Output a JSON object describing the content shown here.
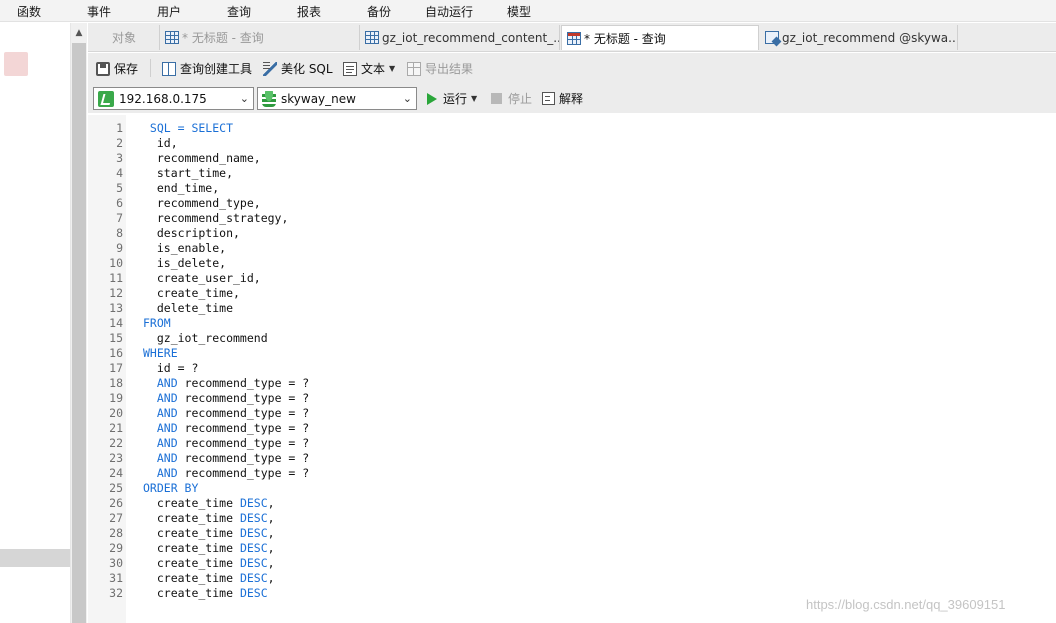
{
  "menu": [
    "函数",
    "事件",
    "用户",
    "查询",
    "报表",
    "备份",
    "自动运行",
    "模型"
  ],
  "tabs": [
    {
      "label": "对象",
      "state": "inactive"
    },
    {
      "label": "* 无标题 - 查询",
      "state": "inactive"
    },
    {
      "label": "gz_iot_recommend_content_...",
      "state": "normal"
    },
    {
      "label": "* 无标题 - 查询",
      "state": "active"
    },
    {
      "label": "gz_iot_recommend @skywa...",
      "state": "normal"
    }
  ],
  "toolbar": {
    "save": "保存",
    "query_builder": "查询创建工具",
    "beautify": "美化 SQL",
    "text": "文本",
    "export": "导出结果"
  },
  "selectors": {
    "connection": "192.168.0.175",
    "database": "skyway_new"
  },
  "run_bar": {
    "run": "运行",
    "stop": "停止",
    "explain": "解释"
  },
  "editor": {
    "lines": [
      {
        "n": "1",
        "parts": [
          {
            "t": " SQL = SELECT",
            "k": true
          }
        ]
      },
      {
        "n": "2",
        "parts": [
          {
            "t": "  id,"
          }
        ]
      },
      {
        "n": "3",
        "parts": [
          {
            "t": "  recommend_name,"
          }
        ]
      },
      {
        "n": "4",
        "parts": [
          {
            "t": "  start_time,"
          }
        ]
      },
      {
        "n": "5",
        "parts": [
          {
            "t": "  end_time,"
          }
        ]
      },
      {
        "n": "6",
        "parts": [
          {
            "t": "  recommend_type,"
          }
        ]
      },
      {
        "n": "7",
        "parts": [
          {
            "t": "  recommend_strategy,"
          }
        ]
      },
      {
        "n": "8",
        "parts": [
          {
            "t": "  description,"
          }
        ]
      },
      {
        "n": "9",
        "parts": [
          {
            "t": "  is_enable,"
          }
        ]
      },
      {
        "n": "10",
        "parts": [
          {
            "t": "  is_delete,"
          }
        ]
      },
      {
        "n": "11",
        "parts": [
          {
            "t": "  create_user_id,"
          }
        ]
      },
      {
        "n": "12",
        "parts": [
          {
            "t": "  create_time,"
          }
        ]
      },
      {
        "n": "13",
        "parts": [
          {
            "t": "  delete_time"
          }
        ]
      },
      {
        "n": "14",
        "parts": [
          {
            "t": "FROM",
            "k": true
          }
        ]
      },
      {
        "n": "15",
        "parts": [
          {
            "t": "  gz_iot_recommend"
          }
        ]
      },
      {
        "n": "16",
        "parts": [
          {
            "t": "WHERE",
            "k": true
          }
        ]
      },
      {
        "n": "17",
        "parts": [
          {
            "t": "  id = ?"
          }
        ]
      },
      {
        "n": "18",
        "parts": [
          {
            "t": "  "
          },
          {
            "t": "AND",
            "k": true
          },
          {
            "t": " recommend_type = ?"
          }
        ]
      },
      {
        "n": "19",
        "parts": [
          {
            "t": "  "
          },
          {
            "t": "AND",
            "k": true
          },
          {
            "t": " recommend_type = ?"
          }
        ]
      },
      {
        "n": "20",
        "parts": [
          {
            "t": "  "
          },
          {
            "t": "AND",
            "k": true
          },
          {
            "t": " recommend_type = ?"
          }
        ]
      },
      {
        "n": "21",
        "parts": [
          {
            "t": "  "
          },
          {
            "t": "AND",
            "k": true
          },
          {
            "t": " recommend_type = ?"
          }
        ]
      },
      {
        "n": "22",
        "parts": [
          {
            "t": "  "
          },
          {
            "t": "AND",
            "k": true
          },
          {
            "t": " recommend_type = ?"
          }
        ]
      },
      {
        "n": "23",
        "parts": [
          {
            "t": "  "
          },
          {
            "t": "AND",
            "k": true
          },
          {
            "t": " recommend_type = ?"
          }
        ]
      },
      {
        "n": "24",
        "parts": [
          {
            "t": "  "
          },
          {
            "t": "AND",
            "k": true
          },
          {
            "t": " recommend_type = ?"
          }
        ]
      },
      {
        "n": "25",
        "parts": [
          {
            "t": "ORDER BY",
            "k": true
          }
        ]
      },
      {
        "n": "26",
        "parts": [
          {
            "t": "  create_time "
          },
          {
            "t": "DESC",
            "k": true
          },
          {
            "t": ","
          }
        ]
      },
      {
        "n": "27",
        "parts": [
          {
            "t": "  create_time "
          },
          {
            "t": "DESC",
            "k": true
          },
          {
            "t": ","
          }
        ]
      },
      {
        "n": "28",
        "parts": [
          {
            "t": "  create_time "
          },
          {
            "t": "DESC",
            "k": true
          },
          {
            "t": ","
          }
        ]
      },
      {
        "n": "29",
        "parts": [
          {
            "t": "  create_time "
          },
          {
            "t": "DESC",
            "k": true
          },
          {
            "t": ","
          }
        ]
      },
      {
        "n": "30",
        "parts": [
          {
            "t": "  create_time "
          },
          {
            "t": "DESC",
            "k": true
          },
          {
            "t": ","
          }
        ]
      },
      {
        "n": "31",
        "parts": [
          {
            "t": "  create_time "
          },
          {
            "t": "DESC",
            "k": true
          },
          {
            "t": ","
          }
        ]
      },
      {
        "n": "32",
        "parts": [
          {
            "t": "  create_time "
          },
          {
            "t": "DESC",
            "k": true
          }
        ]
      }
    ]
  },
  "watermark": "https://blog.csdn.net/qq_39609151",
  "colors": {
    "keyword": "#1a6fd6",
    "run_green": "#2aa63a"
  }
}
